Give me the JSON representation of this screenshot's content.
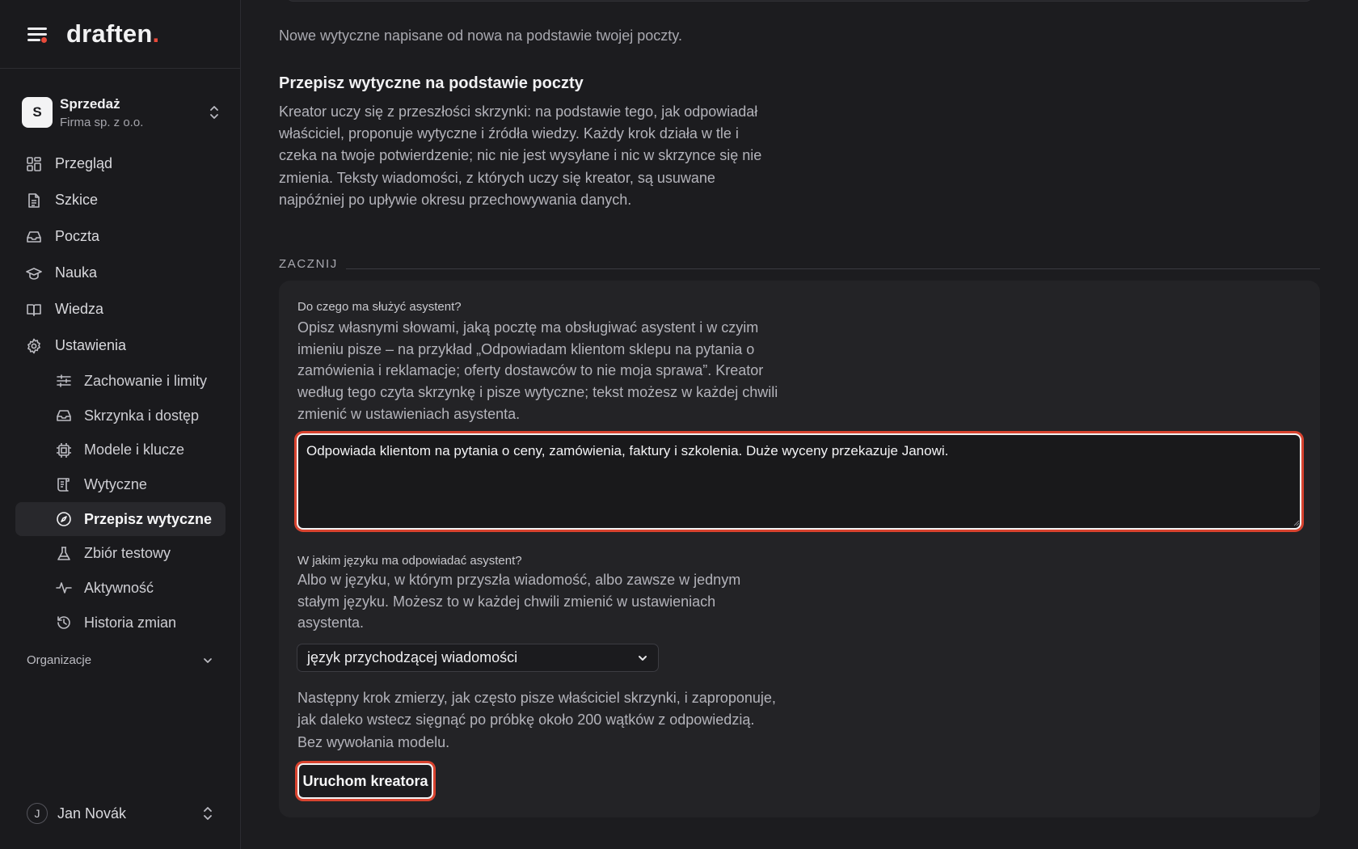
{
  "brand": {
    "name": "draften",
    "dot": "."
  },
  "workspace": {
    "initial": "S",
    "name": "Sprzedaż",
    "company": "Firma sp. z o.o."
  },
  "nav": {
    "items": [
      {
        "label": "Przegląd",
        "icon": "dashboard-icon"
      },
      {
        "label": "Szkice",
        "icon": "document-icon"
      },
      {
        "label": "Poczta",
        "icon": "inbox-icon"
      },
      {
        "label": "Nauka",
        "icon": "graduation-cap-icon"
      },
      {
        "label": "Wiedza",
        "icon": "book-icon"
      },
      {
        "label": "Ustawienia",
        "icon": "gear-icon"
      }
    ],
    "sub_items": [
      {
        "label": "Zachowanie i limity",
        "icon": "sliders-icon"
      },
      {
        "label": "Skrzynka i dostęp",
        "icon": "inbox-icon"
      },
      {
        "label": "Modele i klucze",
        "icon": "chip-icon"
      },
      {
        "label": "Wytyczne",
        "icon": "scroll-icon"
      },
      {
        "label": "Przepisz wytyczne",
        "icon": "compass-icon",
        "active": true
      },
      {
        "label": "Zbiór testowy",
        "icon": "flask-icon"
      },
      {
        "label": "Aktywność",
        "icon": "activity-icon"
      },
      {
        "label": "Historia zmian",
        "icon": "history-icon"
      }
    ],
    "org_label": "Organizacje"
  },
  "user": {
    "initial": "J",
    "name": "Jan Novák"
  },
  "main": {
    "lead": "Nowe wytyczne napisane od nowa na podstawie twojej poczty.",
    "title": "Przepisz wytyczne na podstawie poczty",
    "description": "Kreator uczy się z przeszłości skrzynki: na podstawie tego, jak odpowiadał właściciel, proponuje wytyczne i źródła wiedzy. Każdy krok działa w tle i czeka na twoje potwierdzenie; nic nie jest wysyłane i nic w skrzynce się nie zmienia. Teksty wiadomości, z których uczy się kreator, są usuwane najpóźniej po upływie okresu przechowywania danych.",
    "start_label": "ZACZNIJ",
    "form": {
      "purpose_label": "Do czego ma służyć asystent?",
      "purpose_help": "Opisz własnymi słowami, jaką pocztę ma obsługiwać asystent i w czyim imieniu pisze – na przykład „Odpowiadam klientom sklepu na pytania o zamówienia i reklamacje; oferty dostawców to nie moja sprawa”. Kreator według tego czyta skrzynkę i pisze wytyczne; tekst możesz w każdej chwili zmienić w ustawieniach asystenta.",
      "purpose_value": "Odpowiada klientom na pytania o ceny, zamówienia, faktury i szkolenia. Duże wyceny przekazuje Janowi.",
      "language_label": "W jakim języku ma odpowiadać asystent?",
      "language_help": "Albo w języku, w którym przyszła wiadomość, albo zawsze w jednym stałym języku. Możesz to w każdej chwili zmienić w ustawieniach asystenta.",
      "language_value": "język przychodzącej wiadomości",
      "next_help": "Następny krok zmierzy, jak często pisze właściciel skrzynki, i zaproponuje, jak daleko wstecz sięgnąć po próbkę około 200 wątków z odpowiedzią. Bez wywołania modelu.",
      "run_label": "Uruchom kreatora"
    }
  },
  "colors": {
    "accent": "#e84a3a",
    "focus_ring": "#d8432f",
    "background": "#1c1c1f"
  }
}
